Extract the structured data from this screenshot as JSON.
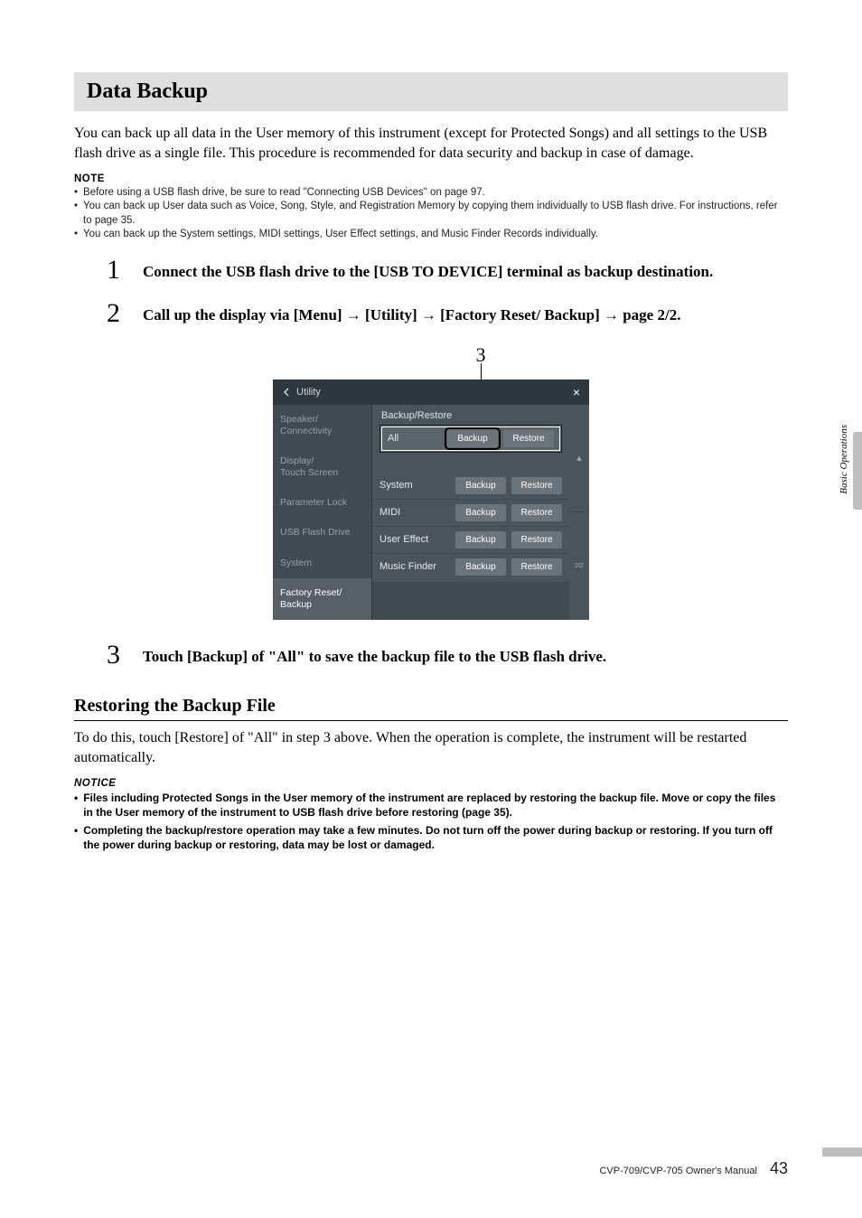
{
  "sectionTitle": "Data Backup",
  "intro": "You can back up all data in the User memory of this instrument (except for Protected Songs) and all settings to the USB flash drive as a single file. This procedure is recommended for data security and backup in case of damage.",
  "noteHead": "NOTE",
  "notes": [
    "Before using a USB flash drive, be sure to read \"Connecting USB Devices\" on page 97.",
    "You can back up User data such as Voice, Song, Style, and Registration Memory by copying them individually to USB flash drive. For instructions, refer to page 35.",
    "You can back up the System settings, MIDI settings, User Effect settings, and Music Finder Records individually."
  ],
  "steps": {
    "s1": {
      "num": "1",
      "text": "Connect the USB flash drive to the [USB TO DEVICE] terminal as backup destination."
    },
    "s2": {
      "num": "2",
      "text": "Call up the display via [Menu] → [Utility] → [Factory Reset/ Backup] → page 2/2."
    },
    "s3": {
      "num": "3",
      "text": "Touch [Backup] of \"All\" to save the backup file to the USB flash drive."
    }
  },
  "calloutThree": "3",
  "screenshot": {
    "title": "Utility",
    "close": "×",
    "pagerUp": "▴",
    "pageIndicator": "2/2",
    "sidebar": [
      "Speaker/\nConnectivity",
      "Display/\nTouch Screen",
      "Parameter Lock",
      "USB Flash Drive",
      "System",
      "Factory Reset/\nBackup"
    ],
    "contentHead": "Backup/Restore",
    "rows": {
      "all": {
        "label": "All",
        "backup": "Backup",
        "restore": "Restore"
      },
      "system": {
        "label": "System",
        "backup": "Backup",
        "restore": "Restore"
      },
      "midi": {
        "label": "MIDI",
        "backup": "Backup",
        "restore": "Restore"
      },
      "ue": {
        "label": "User Effect",
        "backup": "Backup",
        "restore": "Restore"
      },
      "mf": {
        "label": "Music Finder",
        "backup": "Backup",
        "restore": "Restore"
      }
    }
  },
  "subHead": "Restoring the Backup File",
  "subBody": "To do this, touch [Restore] of \"All\" in step 3 above. When the operation is complete, the instrument will be restarted automatically.",
  "noticeHead": "NOTICE",
  "notices": [
    "Files including Protected Songs in the User memory of the instrument are replaced by restoring the backup file. Move or copy the files in the User memory of the instrument to USB flash drive before restoring (page 35).",
    "Completing the backup/restore operation may take a few minutes. Do not turn off the power during backup or restoring. If you turn off the power during backup or restoring, data may be lost or damaged."
  ],
  "sideTab": "Basic Operations",
  "footerText": "CVP-709/CVP-705 Owner's Manual",
  "pageNum": "43"
}
